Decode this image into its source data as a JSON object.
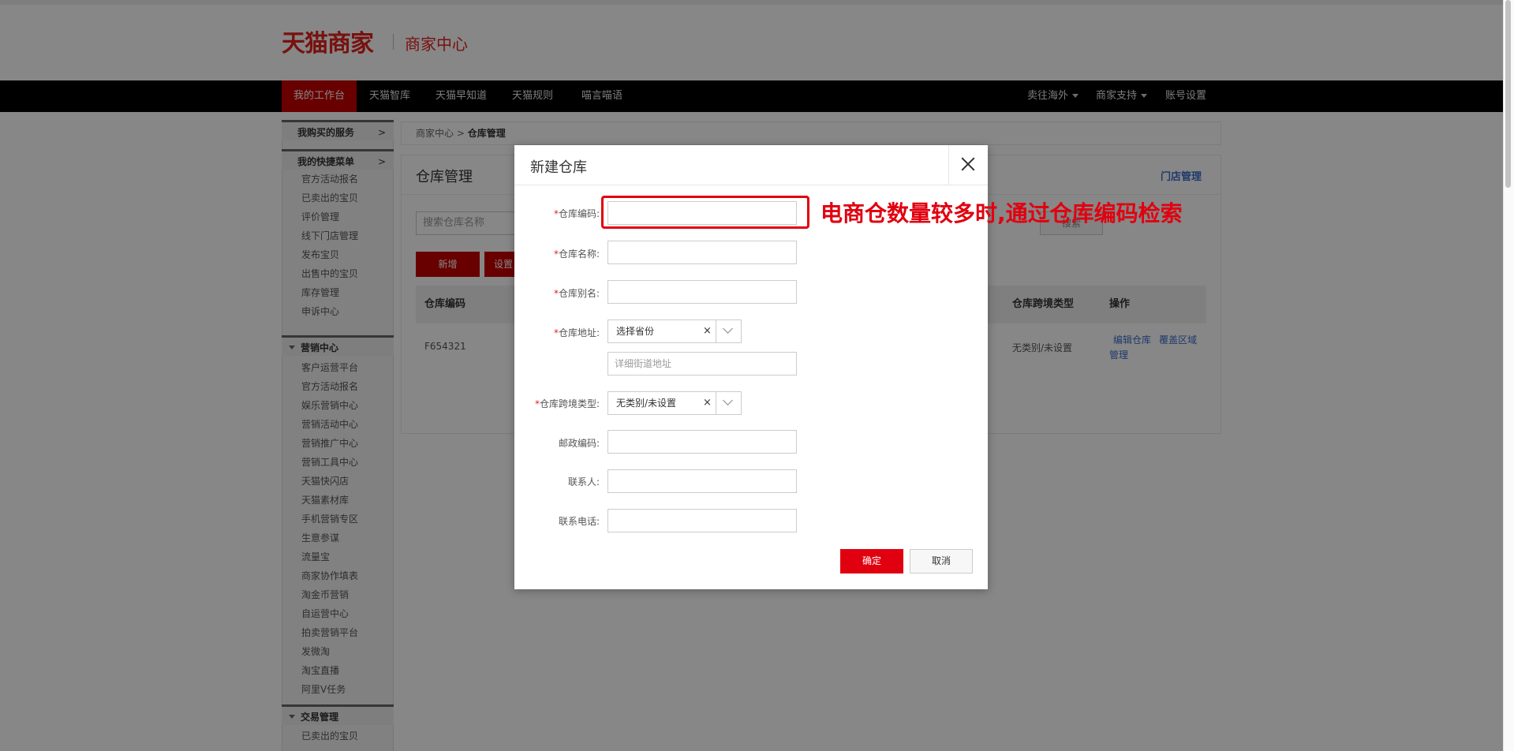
{
  "header": {
    "logo": "天猫商家",
    "subtitle": "商家中心"
  },
  "nav": {
    "left": [
      "我的工作台",
      "天猫智库",
      "天猫早知道",
      "天猫规则",
      "喵言喵语"
    ],
    "right": [
      "卖往海外",
      "商家支持",
      "账号设置"
    ]
  },
  "sidebar": {
    "bought_services": "我购买的服务",
    "quick_menu": "我的快捷菜单",
    "arrow": ">",
    "quick_items": [
      "官方活动报名",
      "已卖出的宝贝",
      "评价管理",
      "线下门店管理",
      "发布宝贝",
      "出售中的宝贝",
      "库存管理",
      "申诉中心"
    ],
    "marketing_title": "营销中心",
    "marketing_items": [
      "客户运营平台",
      "官方活动报名",
      "娱乐营销中心",
      "营销活动中心",
      "营销推广中心",
      "营销工具中心",
      "天猫快闪店",
      "天猫素材库",
      "手机营销专区",
      "生意参谋",
      "流量宝",
      "商家协作填表",
      "淘金币营销",
      "自运营中心",
      "拍卖营销平台",
      "发微淘",
      "淘宝直播",
      "阿里V任务"
    ],
    "trade_title": "交易管理",
    "trade_items": [
      "已卖出的宝贝"
    ]
  },
  "main": {
    "breadcrumb": {
      "root": "商家中心",
      "sep": " > ",
      "current": "仓库管理"
    },
    "title": "仓库管理",
    "store_link": "门店管理",
    "search_placeholder": "搜索仓库名称",
    "search_btn": "搜索",
    "add_btn": "新增",
    "set_btn": "设置",
    "table": {
      "headers": [
        "仓库编码",
        "仓库跨境类型",
        "操作"
      ],
      "row": {
        "code": "F654321",
        "type": "无类别/未设置",
        "actions": [
          "编辑仓库",
          "覆盖区域管理"
        ]
      }
    }
  },
  "modal": {
    "title": "新建仓库",
    "fields": {
      "code": {
        "label": "仓库编码:",
        "required": true
      },
      "name": {
        "label": "仓库名称:",
        "required": true
      },
      "alias": {
        "label": "仓库别名:",
        "required": true
      },
      "address": {
        "label": "仓库地址:",
        "required": true,
        "province": "选择省份",
        "street_placeholder": "详细街道地址"
      },
      "cross_border": {
        "label": "仓库跨境类型:",
        "required": true,
        "value": "无类别/未设置"
      },
      "postcode": {
        "label": "邮政编码:"
      },
      "contact": {
        "label": "联系人:"
      },
      "phone": {
        "label": "联系电话:"
      }
    },
    "clear_symbol": "×",
    "required_mark": "*",
    "confirm": "确定",
    "cancel": "取消"
  },
  "annotation": "电商仓数量较多时,通过仓库编码检索"
}
